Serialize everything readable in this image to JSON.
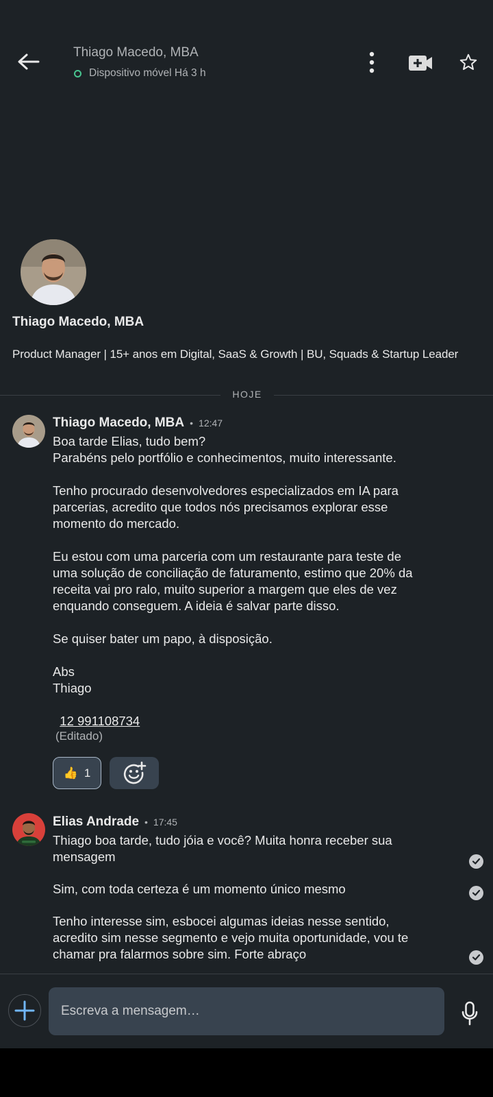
{
  "header": {
    "title": "Thiago Macedo, MBA",
    "status": "Dispositivo móvel Há 3 h"
  },
  "profile": {
    "name": "Thiago Macedo, MBA",
    "headline": "Product Manager | 15+ anos em Digital, SaaS & Growth | BU, Squads & Startup Leader"
  },
  "divider": {
    "label": "HOJE"
  },
  "messages": [
    {
      "sender": "Thiago Macedo, MBA",
      "time": "12:47",
      "text": "Boa tarde Elias, tudo bem?\nParabéns pelo portfólio e conhecimentos, muito interessante.\n\nTenho procurado desenvolvedores especializados em IA para\nparcerias, acredito que todos nós precisamos explorar esse\nmomento do mercado.\n\nEu estou com uma parceria com um restaurante para teste de\numa solução de conciliação de faturamento, estimo que 20% da\nreceita vai pro ralo, muito superior a margem que eles de vez\nenquando conseguem. A ideia é salvar parte disso.\n\nSe quiser bater um papo, à disposição.\n\nAbs\nThiago",
      "phone": "12 991108734",
      "edited": "(Editado)",
      "reaction": {
        "emoji": "👍",
        "count": "1"
      }
    },
    {
      "sender": "Elias Andrade",
      "time": "17:45",
      "paragraphs": [
        "Thiago boa tarde, tudo jóia e você? Muita honra receber sua\nmensagem",
        "Sim, com toda certeza é um momento único mesmo",
        "Tenho interesse sim, esbocei algumas ideias nesse sentido,\nacredito sim nesse segmento e vejo muita oportunidade, vou te\nchamar pra falarmos sobre sim. Forte abraço"
      ]
    }
  ],
  "composer": {
    "placeholder": "Escreva a mensagem…"
  },
  "colors": {
    "background": "#1d2226",
    "online": "#48c590",
    "bubble": "#38434f",
    "link": "#71b7fb"
  }
}
